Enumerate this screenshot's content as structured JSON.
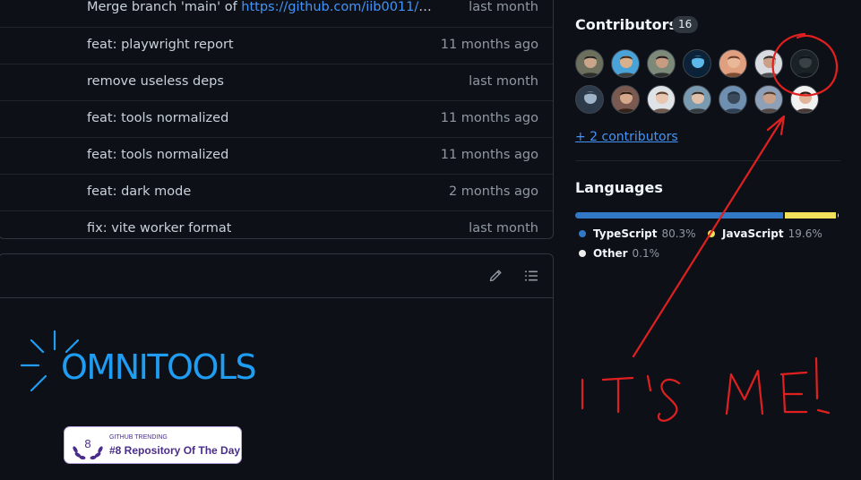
{
  "commits": [
    {
      "message": "Merge branch 'main' of ",
      "link": "https://github.com/iib0011/omni...",
      "time": "last month"
    },
    {
      "message": "feat: playwright report",
      "time": "11 months ago"
    },
    {
      "message": "remove useless deps",
      "time": "last month"
    },
    {
      "message": "feat: tools normalized",
      "time": "11 months ago"
    },
    {
      "message": "feat: tools normalized",
      "time": "11 months ago"
    },
    {
      "message": "feat: dark mode",
      "time": "2 months ago"
    },
    {
      "message": "fix: vite worker format",
      "time": "last month"
    }
  ],
  "readme": {
    "logo_text": "OMNITOOLS",
    "badge": {
      "rank": "8",
      "small": "GITHUB TRENDING",
      "big": "#8 Repository Of The Day"
    },
    "edit_icon": "pencil-icon",
    "toc_icon": "list-icon"
  },
  "sidebar": {
    "contributors_title": "Contributors",
    "contributors_count": "16",
    "more_contributors": "+ 2 contributors",
    "languages_title": "Languages",
    "languages": [
      {
        "name": "TypeScript",
        "percent": "80.3%",
        "value": 80.3,
        "color": "#3178c6"
      },
      {
        "name": "JavaScript",
        "percent": "19.6%",
        "value": 19.6,
        "color": "#f1e05a"
      },
      {
        "name": "Other",
        "percent": "0.1%",
        "value": 0.1,
        "color": "#ededed"
      }
    ]
  },
  "avatars": [
    {
      "bg": "#6b6f5c",
      "skin": "#c9a58a",
      "hair": "#222222"
    },
    {
      "bg": "#4aa3d8",
      "skin": "#d9b08c",
      "hair": "#3b2a1e"
    },
    {
      "bg": "#7d8a7a",
      "skin": "#c89c80",
      "hair": "#1d1d1d"
    },
    {
      "bg": "#0b2238",
      "skin": "#5bb8e8",
      "hair": "#0b2238"
    },
    {
      "bg": "#e0a080",
      "skin": "#e8b898",
      "hair": "#6b3b25"
    },
    {
      "bg": "#d8dbe0",
      "skin": "#caa086",
      "hair": "#333333"
    },
    {
      "bg": "#1a2226",
      "skin": "#3a4248",
      "hair": "#0f1417"
    },
    {
      "bg": "#2d3a4a",
      "skin": "#9fb4c8",
      "hair": "#2d3a4a"
    },
    {
      "bg": "#7a5a50",
      "skin": "#d7a98c",
      "hair": "#2a1a12"
    },
    {
      "bg": "#dfe3e8",
      "skin": "#e8c6b0",
      "hair": "#5a4030"
    },
    {
      "bg": "#7a9ab0",
      "skin": "#e0c0a8",
      "hair": "#2a2a2a"
    },
    {
      "bg": "#6f8fb0",
      "skin": "#3a4a5a",
      "hair": "#223344"
    },
    {
      "bg": "#8da0b8",
      "skin": "#caa088",
      "hair": "#4a3a30"
    },
    {
      "bg": "#f2f2f2",
      "skin": "#e2b49a",
      "hair": "#2a1a14"
    }
  ],
  "annotation": {
    "text": "IT'S ME!",
    "color": "#e02020"
  }
}
